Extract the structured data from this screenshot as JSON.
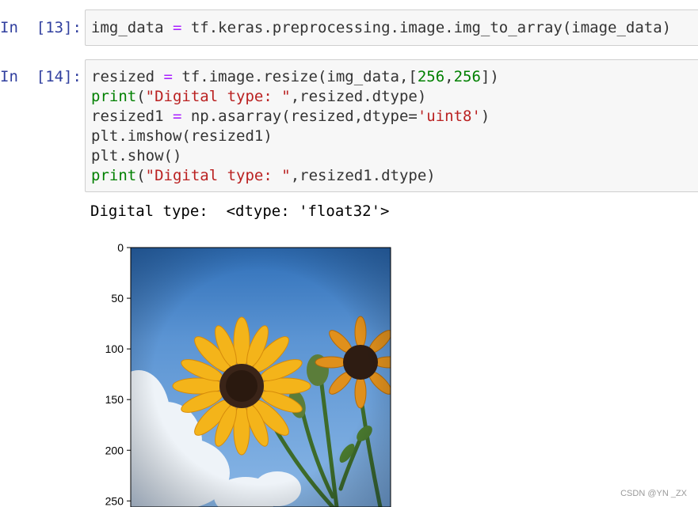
{
  "cells": [
    {
      "prompt": "In  [13]:",
      "lines": [
        [
          {
            "t": "img_data ",
            "c": ""
          },
          {
            "t": "=",
            "c": "op"
          },
          {
            "t": " tf.keras.preprocessing.image.img_to_array(image_data)",
            "c": ""
          }
        ]
      ]
    },
    {
      "prompt": "In  [14]:",
      "lines": [
        [
          {
            "t": "resized ",
            "c": ""
          },
          {
            "t": "=",
            "c": "op"
          },
          {
            "t": " tf.image.resize(img_data,[",
            "c": ""
          },
          {
            "t": "256",
            "c": "num"
          },
          {
            "t": ",",
            "c": ""
          },
          {
            "t": "256",
            "c": "num"
          },
          {
            "t": "])",
            "c": ""
          }
        ],
        [
          {
            "t": "print",
            "c": "kw"
          },
          {
            "t": "(",
            "c": ""
          },
          {
            "t": "\"Digital type: \"",
            "c": "str"
          },
          {
            "t": ",resized.dtype)",
            "c": ""
          }
        ],
        [
          {
            "t": "resized1 ",
            "c": ""
          },
          {
            "t": "=",
            "c": "op"
          },
          {
            "t": " np.asarray(resized,dtype=",
            "c": ""
          },
          {
            "t": "'uint8'",
            "c": "str"
          },
          {
            "t": ")",
            "c": ""
          }
        ],
        [
          {
            "t": "plt.imshow(resized1)",
            "c": ""
          }
        ],
        [
          {
            "t": "plt.show()",
            "c": ""
          }
        ],
        [
          {
            "t": "print",
            "c": "kw"
          },
          {
            "t": "(",
            "c": ""
          },
          {
            "t": "\"Digital type: \"",
            "c": "str"
          },
          {
            "t": ",resized1.dtype)",
            "c": ""
          }
        ]
      ]
    }
  ],
  "output": {
    "text": "Digital type:  <dtype: 'float32'>",
    "plot": {
      "yticks": [
        "0",
        "50",
        "100",
        "150",
        "200",
        "250"
      ],
      "image_subject": "sunflowers against blue sky with clouds"
    }
  },
  "watermark": "CSDN @YN _ZX",
  "colors": {
    "prompt": "#303f9f",
    "cell_bg": "#f7f7f7",
    "cell_border": "#cfcfcf",
    "keyword": "#008000",
    "string": "#ba2121",
    "operator": "#aa22ff"
  }
}
